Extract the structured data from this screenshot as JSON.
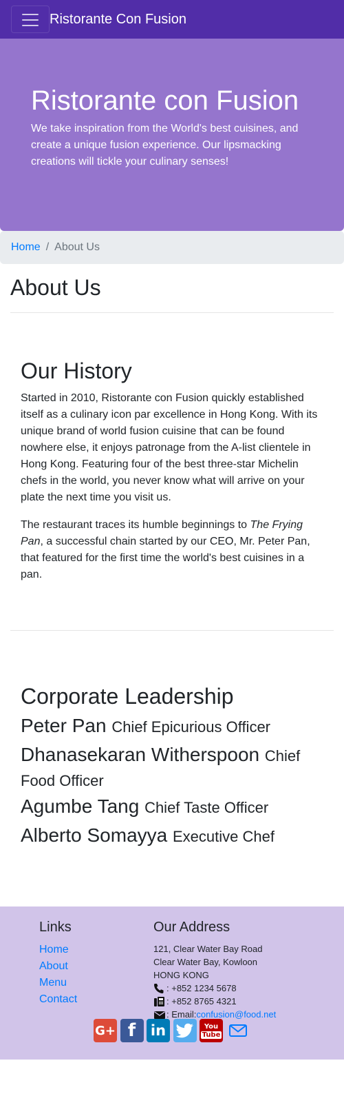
{
  "navbar": {
    "brand": "Ristorante Con Fusion",
    "toggler_icon": "hamburger-menu-icon"
  },
  "jumbotron": {
    "title": "Ristorante con Fusion",
    "text": "We take inspiration from the World's best cuisines, and create a unique fusion experience. Our lipsmacking creations will tickle your culinary senses!"
  },
  "breadcrumb": {
    "home": "Home",
    "separator": "/",
    "current": "About Us"
  },
  "page": {
    "title": "About Us"
  },
  "history": {
    "heading": "Our History",
    "paragraph1": "Started in 2010, Ristorante con Fusion quickly established itself as a culinary icon par excellence in Hong Kong. With its unique brand of world fusion cuisine that can be found nowhere else, it enjoys patronage from the A-list clientele in Hong Kong. Featuring four of the best three-star Michelin chefs in the world, you never know what will arrive on your plate the next time you visit us.",
    "paragraph2_before": "The restaurant traces its humble beginnings to ",
    "paragraph2_italic": "The Frying Pan",
    "paragraph2_after": ", a successful chain started by our CEO, Mr. Peter Pan, that featured for the first time the world's best cuisines in a pan."
  },
  "leadership": {
    "heading": "Corporate Leadership",
    "leaders": [
      {
        "name": "Peter Pan",
        "role": "Chief Epicurious Officer"
      },
      {
        "name": "Dhanasekaran Witherspoon",
        "role": "Chief Food Officer"
      },
      {
        "name": "Agumbe Tang",
        "role": "Chief Taste Officer"
      },
      {
        "name": "Alberto Somayya",
        "role": "Executive Chef"
      }
    ]
  },
  "footer": {
    "links_heading": "Links",
    "links": [
      "Home",
      "About",
      "Menu",
      "Contact"
    ],
    "address_heading": "Our Address",
    "address_lines": [
      "121, Clear Water Bay Road",
      "Clear Water Bay, Kowloon",
      "HONG KONG"
    ],
    "phone": ": +852 1234 5678",
    "fax": ": +852 8765 4321",
    "email_label": ": Email: ",
    "email": "confusion@food.net",
    "contact_icons": [
      "phone-icon",
      "fax-icon",
      "envelope-icon"
    ],
    "social": [
      {
        "icon": "google-plus-icon",
        "color": "#dd4b39"
      },
      {
        "icon": "facebook-icon",
        "color": "#3b5998"
      },
      {
        "icon": "linkedin-icon",
        "color": "#007bb6"
      },
      {
        "icon": "twitter-icon",
        "color": "#55acee"
      },
      {
        "icon": "youtube-icon",
        "color": "#bb0000"
      },
      {
        "icon": "mail-icon",
        "color": "#007bff"
      }
    ]
  },
  "colors": {
    "navbar": "#512da8",
    "jumbotron": "#9575cd",
    "footer": "#d1c4e9",
    "link": "#007bff",
    "breadcrumb_bg": "#e9ecef"
  }
}
